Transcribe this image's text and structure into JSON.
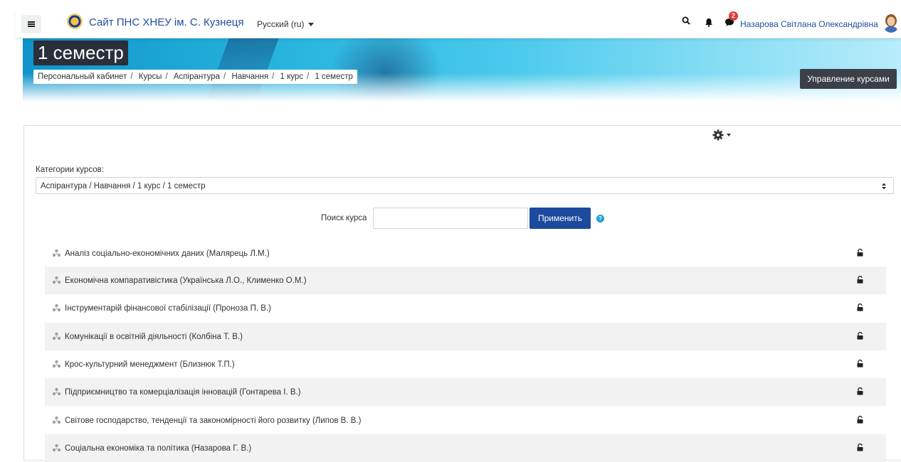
{
  "header": {
    "site_title": "Сайт ПНС ХНЕУ ім. С. Кузнеця",
    "language": "Русский (ru)",
    "notification_count": "2",
    "user_name": "Назарова Світлана Олександрівна"
  },
  "page": {
    "heading": "1 семестр",
    "breadcrumb": [
      "Персональный кабинет",
      "Курсы",
      "Аспірантура",
      "Навчання",
      "1 курс",
      "1 семестр"
    ],
    "manage_button": "Управление курсами"
  },
  "filter": {
    "category_label": "Категории курсов:",
    "category_value": "Аспірантура / Навчання / 1 курс / 1 семестр",
    "search_label": "Поиск курса",
    "search_value": "",
    "apply_button": "Применить",
    "help_glyph": "?"
  },
  "courses": [
    "Аналіз соціально-економічних даних (Малярець Л.М.)",
    "Економічна компаративістика (Українська Л.О., Клименко О.М.)",
    "Інструментарій фінансової стабілізації (Проноза П. В.)",
    "Комунікації в освітній діяльності (Колбіна Т. В.)",
    "Крос-культурний менеджмент (Близнюк Т.П.)",
    "Підприємництво та комерціалізація інновацій (Гонтарева І. В.)",
    "Світове господарство, тенденції та закономірності його розвитку (Липов В. В.)",
    "Соціальна економіка та політика (Назарова Г. В.)"
  ],
  "colors": {
    "accent": "#1c4a9e",
    "link": "#1f4e9c",
    "badge": "#e53935",
    "row_alt": "#f2f2f2"
  },
  "icons": [
    "menu-icon",
    "site-logo",
    "search-icon",
    "bell-icon",
    "message-icon",
    "gear-icon",
    "course-icon",
    "lock-icon",
    "help-icon"
  ]
}
